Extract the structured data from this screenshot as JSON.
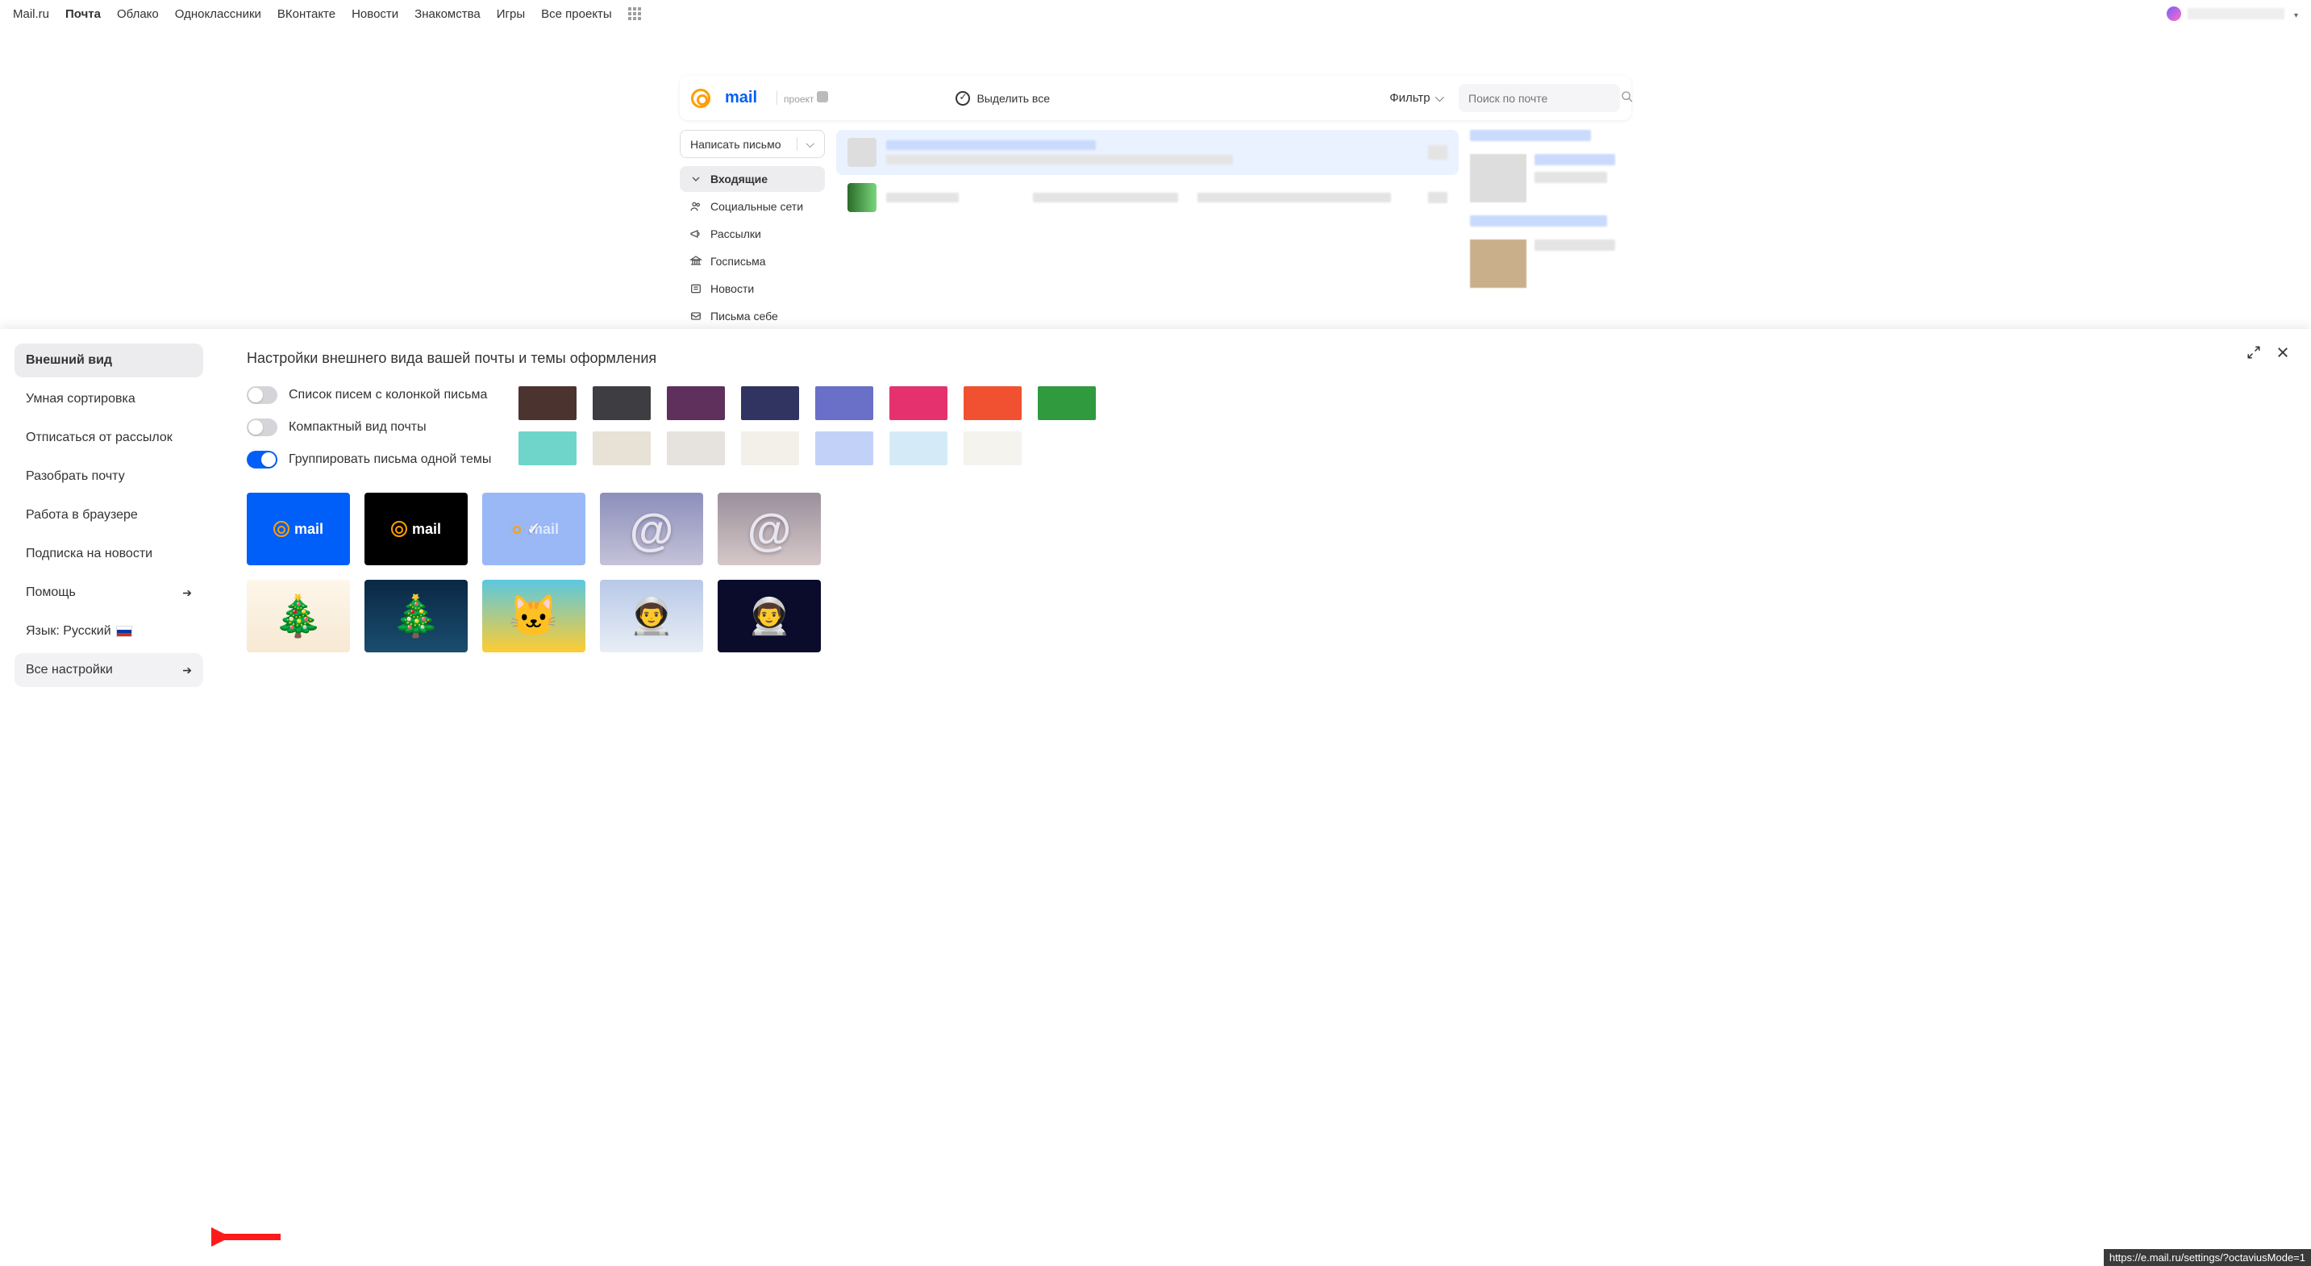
{
  "topnav": {
    "items": [
      "Mail.ru",
      "Почта",
      "Облако",
      "Одноклассники",
      "ВКонтакте",
      "Новости",
      "Знакомства",
      "Игры",
      "Все проекты"
    ],
    "active_index": 1
  },
  "mail_header": {
    "logo_text": "mail",
    "logo_sub": "проект",
    "select_all": "Выделить все",
    "filter": "Фильтр",
    "search_placeholder": "Поиск по почте"
  },
  "compose_label": "Написать письмо",
  "folders": [
    {
      "label": "Входящие",
      "icon": "chevron-down",
      "active": true
    },
    {
      "label": "Социальные сети",
      "icon": "people"
    },
    {
      "label": "Рассылки",
      "icon": "megaphone"
    },
    {
      "label": "Госписьма",
      "icon": "gov"
    },
    {
      "label": "Новости",
      "icon": "news"
    },
    {
      "label": "Письма себе",
      "icon": "self"
    }
  ],
  "settings": {
    "title": "Настройки внешнего вида вашей почты и темы оформления",
    "sidebar": [
      {
        "label": "Внешний вид",
        "active": true
      },
      {
        "label": "Умная сортировка"
      },
      {
        "label": "Отписаться от рассылок"
      },
      {
        "label": "Разобрать почту"
      },
      {
        "label": "Работа в браузере"
      },
      {
        "label": "Подписка на новости"
      },
      {
        "label": "Помощь",
        "arrow": true
      },
      {
        "label": "Язык: Русский",
        "flag": true
      },
      {
        "label": "Все настройки",
        "arrow": true,
        "highlight": true
      }
    ],
    "toggles": [
      {
        "label": "Список писем с колонкой письма",
        "on": false
      },
      {
        "label": "Компактный вид почты",
        "on": false
      },
      {
        "label": "Группировать письма одной темы",
        "on": true
      }
    ],
    "swatches_row1": [
      "#4b3330",
      "#3e3d42",
      "#5f305c",
      "#313360",
      "#6a6fc7",
      "#e5326f",
      "#f15131",
      "#2f9a3e"
    ],
    "swatches_row2": [
      "#6fd5ca",
      "#e8e1d6",
      "#e6e2de",
      "#f3efe9",
      "#c2d1f7",
      "#d4ebf7",
      "#f5f3ee"
    ],
    "theme_logo_text": "mail",
    "theme_selected_index": 2
  },
  "url_tooltip": "https://e.mail.ru/settings/?octaviusMode=1"
}
